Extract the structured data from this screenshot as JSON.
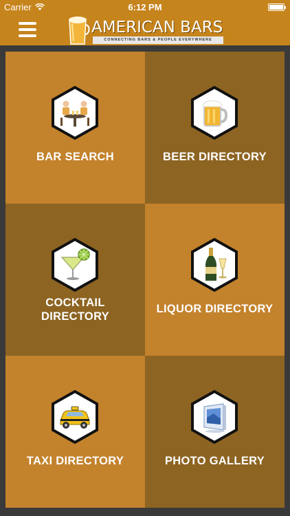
{
  "status_bar": {
    "carrier": "Carrier",
    "time": "6:12 PM"
  },
  "header": {
    "logo_title": "AMERICAN BARS",
    "logo_subtitle": "CONNECTING BARS & PEOPLE EVERYWHERE"
  },
  "tiles": [
    {
      "label": "BAR SEARCH",
      "icon": "bar-table-icon"
    },
    {
      "label": "BEER DIRECTORY",
      "icon": "beer-mug-icon"
    },
    {
      "label_lines": [
        "COCKTAIL",
        "DIRECTORY"
      ],
      "icon": "cocktail-glass-icon"
    },
    {
      "label": "LIQUOR DIRECTORY",
      "icon": "champagne-icon"
    },
    {
      "label": "TAXI DIRECTORY",
      "icon": "taxi-icon"
    },
    {
      "label": "PHOTO GALLERY",
      "icon": "photo-booth-icon"
    }
  ],
  "colors": {
    "header": "#c6841c",
    "tile_light": "#c3822c",
    "tile_dark": "#8d6422",
    "background": "#3a3a3a"
  }
}
